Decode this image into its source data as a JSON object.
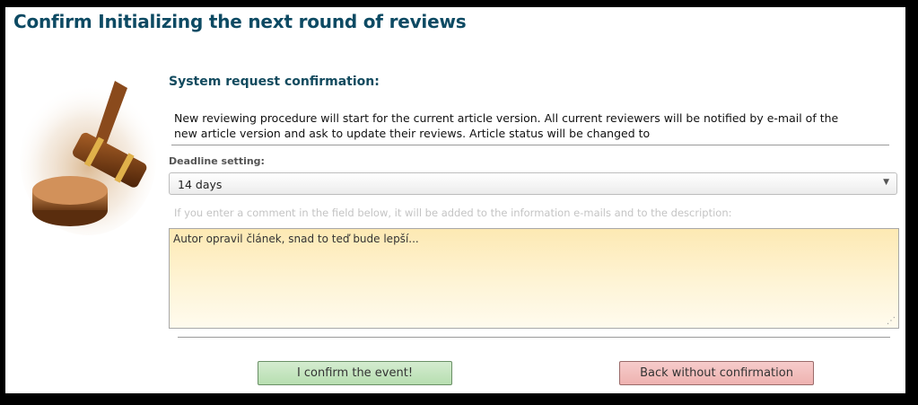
{
  "page": {
    "title": "Confirm Initializing the next round of reviews"
  },
  "confirmation": {
    "heading": "System request confirmation:",
    "message": "New reviewing procedure will start for the current article version. All current reviewers will be notified by e-mail of the new article version and ask to update their reviews. Article status will be changed to"
  },
  "deadline": {
    "label": "Deadline setting:",
    "selected": "14 days"
  },
  "comment": {
    "hint": "If you enter a comment in the field below, it will be added to the information e-mails and to the description:",
    "value": "Autor opravil článek, snad to teď bude lepší..."
  },
  "buttons": {
    "confirm_label": "I confirm the event!",
    "back_label": "Back without confirmation"
  },
  "icons": {
    "illustration": "gavel-icon"
  },
  "colors": {
    "title": "#0d4a63",
    "confirm_button": "#c6e5c1",
    "back_button": "#f2bebd",
    "comment_background": "#fdf0c7"
  }
}
